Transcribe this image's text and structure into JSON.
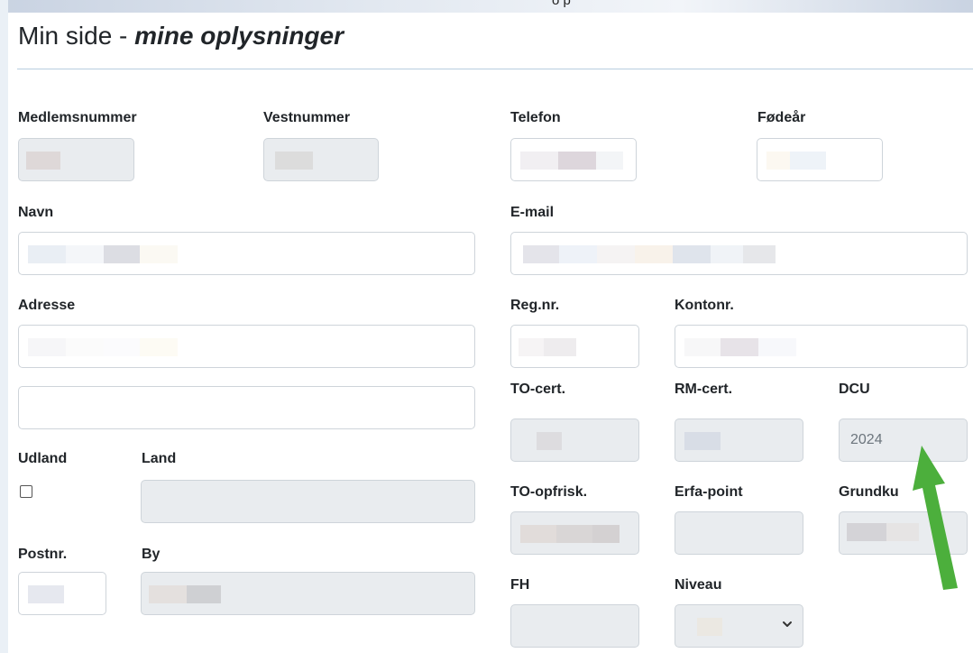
{
  "header": {
    "title_prefix": "Min side - ",
    "title_emphasis": "mine oplysninger"
  },
  "top_fragment": "o      p",
  "labels": {
    "medlemsnummer": "Medlemsnummer",
    "vestnummer": "Vestnummer",
    "telefon": "Telefon",
    "foedeaar": "Fødeår",
    "navn": "Navn",
    "email": "E-mail",
    "adresse": "Adresse",
    "regnr": "Reg.nr.",
    "kontonr": "Kontonr.",
    "to_cert": "TO-cert.",
    "rm_cert": "RM-cert.",
    "dcu": "DCU",
    "udland": "Udland",
    "land": "Land",
    "to_opfrisk": "TO-opfrisk.",
    "erfa_point": "Erfa-point",
    "grundkursus": "Grundku",
    "postnr": "Postnr.",
    "by": "By",
    "fh": "FH",
    "niveau": "Niveau"
  },
  "values": {
    "dcu": "2024"
  },
  "form_state": {
    "udland_checked": false
  },
  "annotation": {
    "arrow_color": "#4caf3c",
    "arrow_target": "DCU"
  }
}
